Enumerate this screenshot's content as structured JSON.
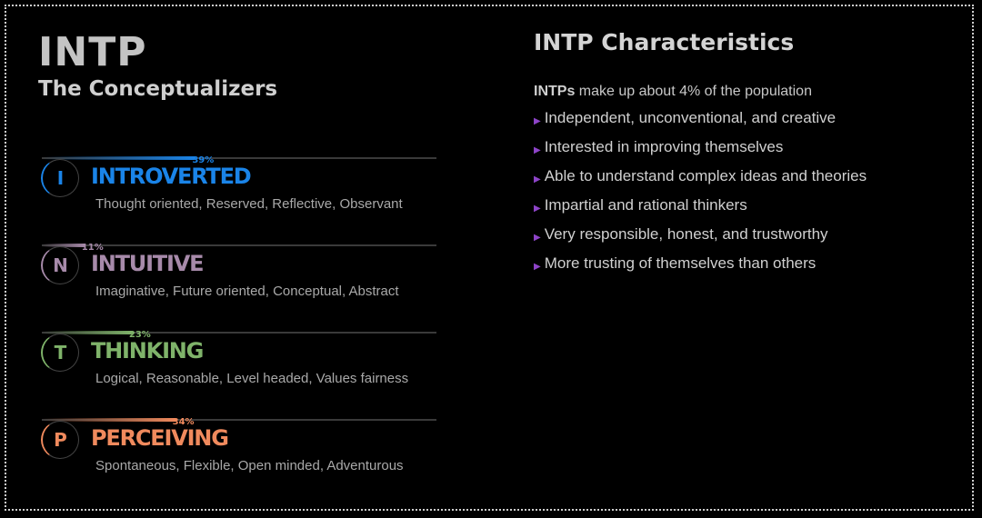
{
  "type": {
    "code": "INTP",
    "name": "The Conceptualizers"
  },
  "traits": [
    {
      "letter": "I",
      "label": "INTROVERTED",
      "percent": 39,
      "percent_label": "39%",
      "color": "#1a84e8",
      "description": "Thought oriented, Reserved, Reflective, Observant"
    },
    {
      "letter": "N",
      "label": "INTUITIVE",
      "percent": 11,
      "percent_label": "11%",
      "color": "#a78aaa",
      "description": "Imaginative, Future oriented, Conceptual, Abstract"
    },
    {
      "letter": "T",
      "label": "THINKING",
      "percent": 23,
      "percent_label": "23%",
      "color": "#7fb36a",
      "description": "Logical, Reasonable, Level headed, Values fairness"
    },
    {
      "letter": "P",
      "label": "PERCEIVING",
      "percent": 34,
      "percent_label": "34%",
      "color": "#f08a5d",
      "description": "Spontaneous, Flexible, Open minded, Adventurous"
    }
  ],
  "characteristics": {
    "title": "INTP Characteristics",
    "population_prefix": "INTPs",
    "population_text": " make up about 4% of the population",
    "bullet_color": "#8e44c9",
    "items": [
      "Independent, unconventional, and creative",
      "Interested in improving themselves",
      "Able to understand complex ideas and theories",
      "Impartial and rational thinkers",
      "Very responsible, honest, and trustworthy",
      "More trusting of themselves than others"
    ]
  }
}
